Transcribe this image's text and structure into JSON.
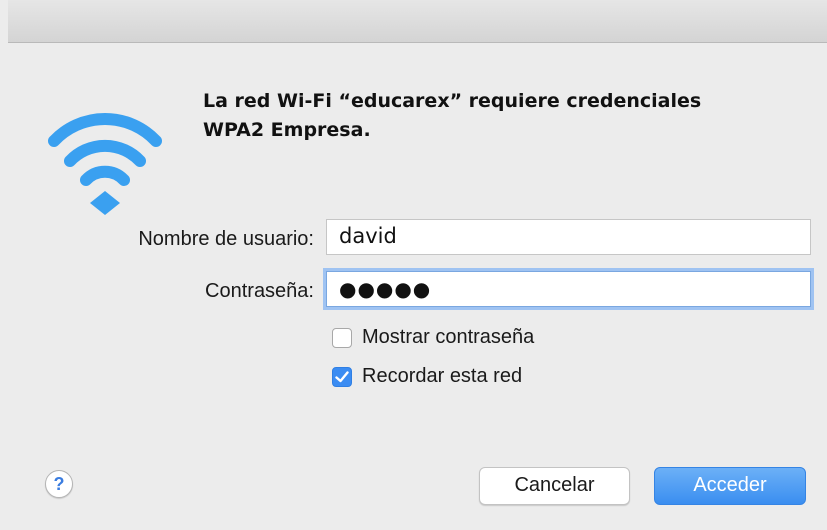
{
  "dialog": {
    "heading_line1": "La red Wi-Fi “educarex” requiere credenciales",
    "heading_line2": "WPA2 Empresa."
  },
  "form": {
    "username_label": "Nombre de usuario:",
    "username_value": "david",
    "password_label": "Contraseña:",
    "password_mask": "●●●●●"
  },
  "options": {
    "show_password_label": "Mostrar contraseña",
    "show_password_checked": false,
    "remember_label": "Recordar esta red",
    "remember_checked": true
  },
  "buttons": {
    "help": "?",
    "cancel": "Cancelar",
    "ok": "Acceder"
  },
  "colors": {
    "accent": "#3b8cf2",
    "wifi": "#3aa0f0"
  },
  "icons": {
    "wifi": "wifi-icon",
    "checkmark": "checkmark-icon",
    "help": "help-icon"
  }
}
